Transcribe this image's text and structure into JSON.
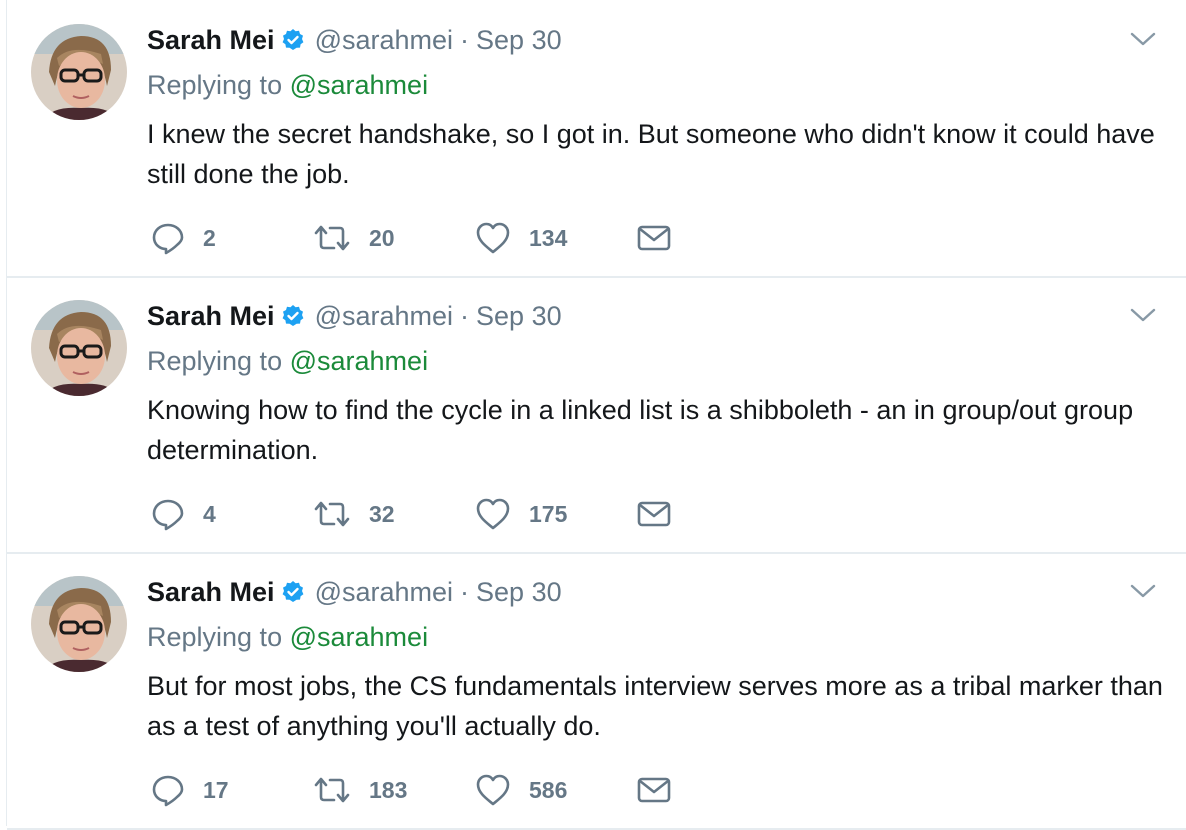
{
  "tweets": [
    {
      "author": {
        "name": "Sarah Mei",
        "handle": "@sarahmei",
        "verified": true
      },
      "separator": "·",
      "time": "Sep 30",
      "reply_prefix": "Replying to",
      "reply_to": "@sarahmei",
      "text": "I knew the secret handshake, so I got in. But someone who didn't know it could have still done the job.",
      "stats": {
        "replies": "2",
        "retweets": "20",
        "likes": "134"
      }
    },
    {
      "author": {
        "name": "Sarah Mei",
        "handle": "@sarahmei",
        "verified": true
      },
      "separator": "·",
      "time": "Sep 30",
      "reply_prefix": "Replying to",
      "reply_to": "@sarahmei",
      "text": "Knowing how to find the cycle in a linked list is a shibboleth - an in group/out group determination.",
      "stats": {
        "replies": "4",
        "retweets": "32",
        "likes": "175"
      }
    },
    {
      "author": {
        "name": "Sarah Mei",
        "handle": "@sarahmei",
        "verified": true
      },
      "separator": "·",
      "time": "Sep 30",
      "reply_prefix": "Replying to",
      "reply_to": "@sarahmei",
      "text": "But for most jobs, the CS fundamentals interview serves more as a tribal marker than as a test of anything you'll actually do.",
      "stats": {
        "replies": "17",
        "retweets": "183",
        "likes": "586"
      }
    }
  ],
  "icons": {
    "verified": "verified-badge-icon",
    "caret": "chevron-down-icon",
    "reply": "reply-icon",
    "retweet": "retweet-icon",
    "like": "heart-icon",
    "dm": "envelope-icon"
  },
  "colors": {
    "text": "#14171a",
    "secondary": "#657786",
    "mention": "#1b8a3a",
    "verified": "#1da1f2",
    "divider": "#e6ecf0"
  }
}
